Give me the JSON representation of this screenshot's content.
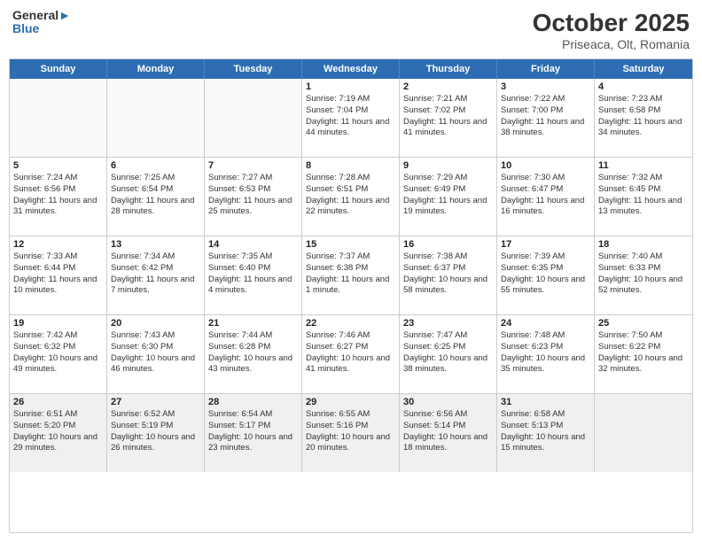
{
  "header": {
    "logo_line1": "General",
    "logo_line2": "Blue",
    "title": "October 2025",
    "subtitle": "Priseaca, Olt, Romania"
  },
  "days_of_week": [
    "Sunday",
    "Monday",
    "Tuesday",
    "Wednesday",
    "Thursday",
    "Friday",
    "Saturday"
  ],
  "rows": [
    [
      {
        "day": "",
        "text": ""
      },
      {
        "day": "",
        "text": ""
      },
      {
        "day": "",
        "text": ""
      },
      {
        "day": "1",
        "text": "Sunrise: 7:19 AM\nSunset: 7:04 PM\nDaylight: 11 hours and 44 minutes."
      },
      {
        "day": "2",
        "text": "Sunrise: 7:21 AM\nSunset: 7:02 PM\nDaylight: 11 hours and 41 minutes."
      },
      {
        "day": "3",
        "text": "Sunrise: 7:22 AM\nSunset: 7:00 PM\nDaylight: 11 hours and 38 minutes."
      },
      {
        "day": "4",
        "text": "Sunrise: 7:23 AM\nSunset: 6:58 PM\nDaylight: 11 hours and 34 minutes."
      }
    ],
    [
      {
        "day": "5",
        "text": "Sunrise: 7:24 AM\nSunset: 6:56 PM\nDaylight: 11 hours and 31 minutes."
      },
      {
        "day": "6",
        "text": "Sunrise: 7:25 AM\nSunset: 6:54 PM\nDaylight: 11 hours and 28 minutes."
      },
      {
        "day": "7",
        "text": "Sunrise: 7:27 AM\nSunset: 6:53 PM\nDaylight: 11 hours and 25 minutes."
      },
      {
        "day": "8",
        "text": "Sunrise: 7:28 AM\nSunset: 6:51 PM\nDaylight: 11 hours and 22 minutes."
      },
      {
        "day": "9",
        "text": "Sunrise: 7:29 AM\nSunset: 6:49 PM\nDaylight: 11 hours and 19 minutes."
      },
      {
        "day": "10",
        "text": "Sunrise: 7:30 AM\nSunset: 6:47 PM\nDaylight: 11 hours and 16 minutes."
      },
      {
        "day": "11",
        "text": "Sunrise: 7:32 AM\nSunset: 6:45 PM\nDaylight: 11 hours and 13 minutes."
      }
    ],
    [
      {
        "day": "12",
        "text": "Sunrise: 7:33 AM\nSunset: 6:44 PM\nDaylight: 11 hours and 10 minutes."
      },
      {
        "day": "13",
        "text": "Sunrise: 7:34 AM\nSunset: 6:42 PM\nDaylight: 11 hours and 7 minutes."
      },
      {
        "day": "14",
        "text": "Sunrise: 7:35 AM\nSunset: 6:40 PM\nDaylight: 11 hours and 4 minutes."
      },
      {
        "day": "15",
        "text": "Sunrise: 7:37 AM\nSunset: 6:38 PM\nDaylight: 11 hours and 1 minute."
      },
      {
        "day": "16",
        "text": "Sunrise: 7:38 AM\nSunset: 6:37 PM\nDaylight: 10 hours and 58 minutes."
      },
      {
        "day": "17",
        "text": "Sunrise: 7:39 AM\nSunset: 6:35 PM\nDaylight: 10 hours and 55 minutes."
      },
      {
        "day": "18",
        "text": "Sunrise: 7:40 AM\nSunset: 6:33 PM\nDaylight: 10 hours and 52 minutes."
      }
    ],
    [
      {
        "day": "19",
        "text": "Sunrise: 7:42 AM\nSunset: 6:32 PM\nDaylight: 10 hours and 49 minutes."
      },
      {
        "day": "20",
        "text": "Sunrise: 7:43 AM\nSunset: 6:30 PM\nDaylight: 10 hours and 46 minutes."
      },
      {
        "day": "21",
        "text": "Sunrise: 7:44 AM\nSunset: 6:28 PM\nDaylight: 10 hours and 43 minutes."
      },
      {
        "day": "22",
        "text": "Sunrise: 7:46 AM\nSunset: 6:27 PM\nDaylight: 10 hours and 41 minutes."
      },
      {
        "day": "23",
        "text": "Sunrise: 7:47 AM\nSunset: 6:25 PM\nDaylight: 10 hours and 38 minutes."
      },
      {
        "day": "24",
        "text": "Sunrise: 7:48 AM\nSunset: 6:23 PM\nDaylight: 10 hours and 35 minutes."
      },
      {
        "day": "25",
        "text": "Sunrise: 7:50 AM\nSunset: 6:22 PM\nDaylight: 10 hours and 32 minutes."
      }
    ],
    [
      {
        "day": "26",
        "text": "Sunrise: 6:51 AM\nSunset: 5:20 PM\nDaylight: 10 hours and 29 minutes."
      },
      {
        "day": "27",
        "text": "Sunrise: 6:52 AM\nSunset: 5:19 PM\nDaylight: 10 hours and 26 minutes."
      },
      {
        "day": "28",
        "text": "Sunrise: 6:54 AM\nSunset: 5:17 PM\nDaylight: 10 hours and 23 minutes."
      },
      {
        "day": "29",
        "text": "Sunrise: 6:55 AM\nSunset: 5:16 PM\nDaylight: 10 hours and 20 minutes."
      },
      {
        "day": "30",
        "text": "Sunrise: 6:56 AM\nSunset: 5:14 PM\nDaylight: 10 hours and 18 minutes."
      },
      {
        "day": "31",
        "text": "Sunrise: 6:58 AM\nSunset: 5:13 PM\nDaylight: 10 hours and 15 minutes."
      },
      {
        "day": "",
        "text": ""
      }
    ]
  ]
}
